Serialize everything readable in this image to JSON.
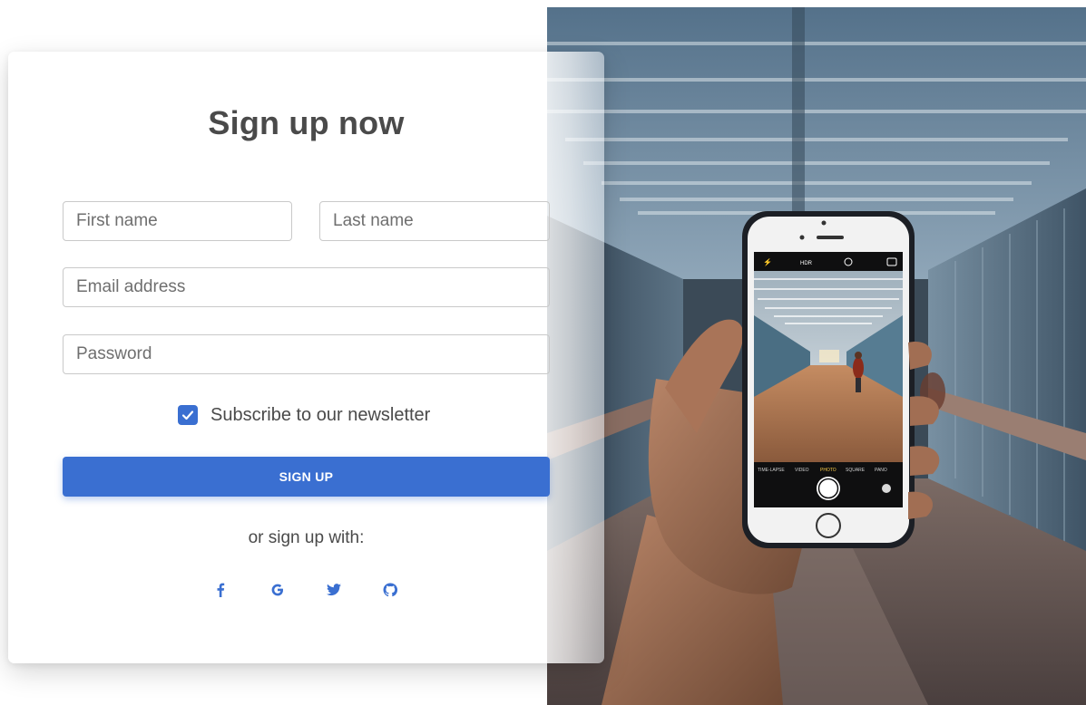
{
  "form": {
    "title": "Sign up now",
    "first_name_placeholder": "First name",
    "last_name_placeholder": "Last name",
    "email_placeholder": "Email address",
    "password_placeholder": "Password",
    "newsletter_label": "Subscribe to our newsletter",
    "newsletter_checked": true,
    "submit_label": "SIGN UP",
    "social_prompt": "or sign up with:",
    "social": [
      {
        "icon": "facebook-icon"
      },
      {
        "icon": "google-icon"
      },
      {
        "icon": "twitter-icon"
      },
      {
        "icon": "github-icon"
      }
    ]
  },
  "photo": {
    "camera_modes": [
      "TIME-LAPSE",
      "VIDEO",
      "PHOTO",
      "SQUARE",
      "PANO"
    ],
    "active_mode": "PHOTO",
    "hdr_label": "HDR"
  },
  "colors": {
    "primary": "#3a6fd1",
    "title": "#4a4a4a",
    "active_mode": "#f7c948"
  }
}
